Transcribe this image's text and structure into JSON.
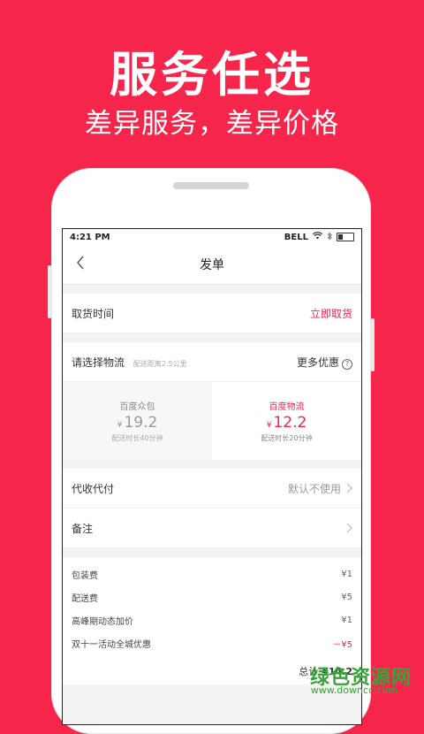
{
  "promo": {
    "headline": "服务任选",
    "subline": "差异服务，差异价格"
  },
  "status": {
    "time": "4:21 PM",
    "carrier": "BELL"
  },
  "nav": {
    "title": "发单"
  },
  "pickup": {
    "label": "取货时间",
    "value": "立即取货"
  },
  "logistics": {
    "label": "请选择物流",
    "distance": "配送距离2.5公里",
    "more": "更多优惠",
    "options": [
      {
        "name": "百度众包",
        "currency": "¥",
        "price": "19.2",
        "eta": "配送时长40分钟"
      },
      {
        "name": "百度物流",
        "currency": "¥",
        "price": "12.2",
        "eta": "配送时长20分钟"
      }
    ]
  },
  "cod": {
    "label": "代收代付",
    "value": "默认不使用"
  },
  "remark": {
    "label": "备注"
  },
  "fees": [
    {
      "label": "包装费",
      "amount": "¥1"
    },
    {
      "label": "配送费",
      "amount": "¥5"
    },
    {
      "label": "高峰期动态加价",
      "amount": "¥1"
    },
    {
      "label": "双十一活动全城优惠",
      "amount": "－¥5"
    }
  ],
  "total": {
    "label": "总计",
    "amount": "¥14.2"
  },
  "watermark": {
    "text": "绿色资源网",
    "url": "www.downcc.com"
  },
  "colors": {
    "brand": "#f5254c",
    "watermark": "#3aa23a"
  }
}
